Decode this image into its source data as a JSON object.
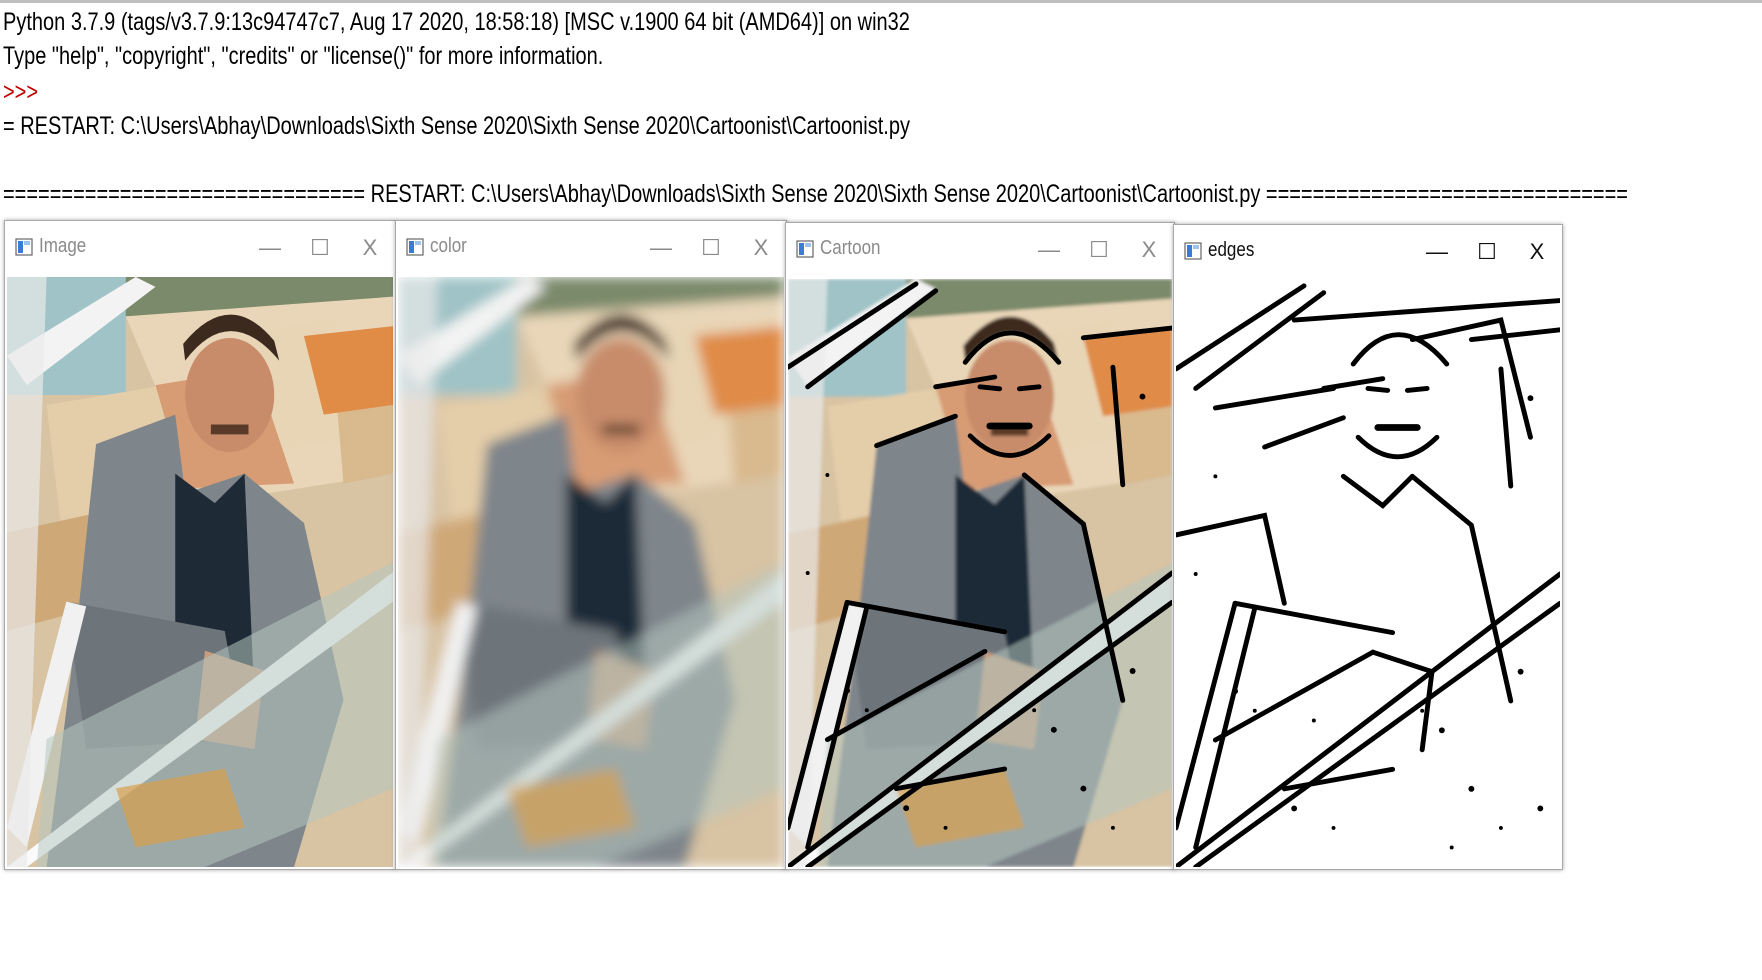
{
  "shell": {
    "lines": [
      "Python 3.7.9 (tags/v3.7.9:13c94747c7, Aug 17 2020, 18:58:18) [MSC v.1900 64 bit (AMD64)] on win32",
      "Type \"help\", \"copyright\", \"credits\" or \"license()\" for more information.",
      ">>>",
      "= RESTART: C:\\Users\\Abhay\\Downloads\\Sixth Sense 2020\\Sixth Sense 2020\\Cartoonist\\Cartoonist.py",
      "=============================== RESTART: C:\\Users\\Abhay\\Downloads\\Sixth Sense 2020\\Sixth Sense 2020\\Cartoonist\\Cartoonist.py ==============================="
    ]
  },
  "windows": [
    {
      "title": "Image",
      "minimize": "—",
      "maximize": "☐",
      "close": "X",
      "active": false
    },
    {
      "title": "color",
      "minimize": "—",
      "maximize": "☐",
      "close": "X",
      "active": false
    },
    {
      "title": "Cartoon",
      "minimize": "—",
      "maximize": "☐",
      "close": "X",
      "active": false
    },
    {
      "title": "edges",
      "minimize": "—",
      "maximize": "☐",
      "close": "X",
      "active": true
    }
  ],
  "icons": {
    "app": "window-app-icon",
    "minimize": "minimize-icon",
    "maximize": "maximize-icon",
    "close": "close-icon"
  },
  "colors": {
    "prompt": "#c00000",
    "inactive_title": "#8a8a8a",
    "active_title": "#111111"
  }
}
